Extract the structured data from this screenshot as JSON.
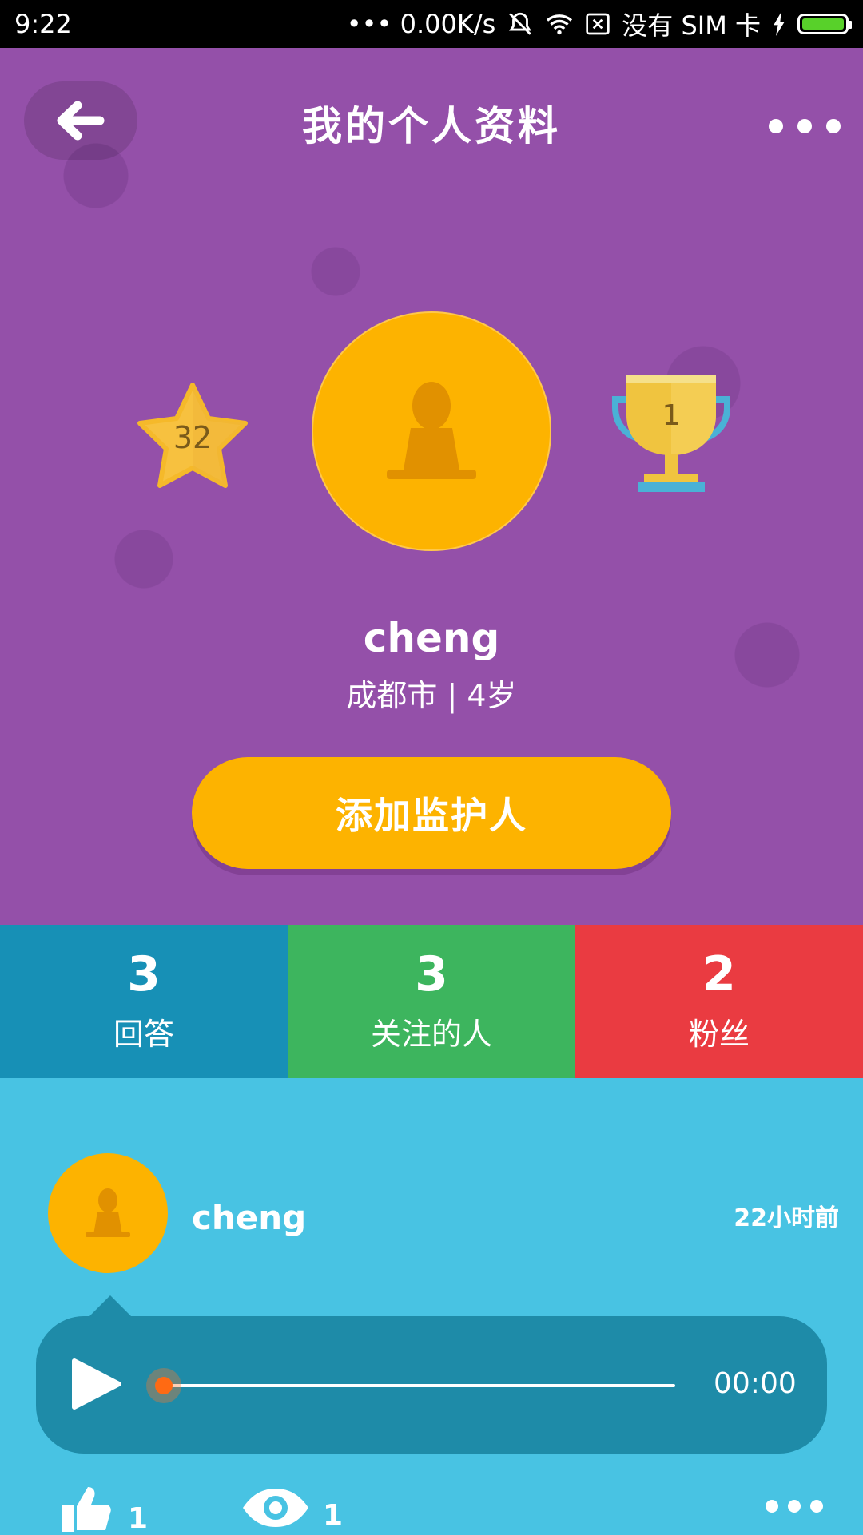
{
  "status_bar": {
    "time": "9:22",
    "net_speed": "••• 0.00K/s",
    "sim_text": "没有 SIM 卡",
    "icons": [
      "mute-icon",
      "wifi-icon",
      "no-sim-icon",
      "charging-icon",
      "battery-icon"
    ]
  },
  "header": {
    "title": "我的个人资料",
    "back_icon": "arrow-left-icon",
    "more_icon": "more-dots-icon"
  },
  "profile": {
    "star_count": "32",
    "trophy_count": "1",
    "name": "cheng",
    "location_age": "成都市 | 4岁",
    "guardian_button": "添加监护人"
  },
  "stats": [
    {
      "count": "3",
      "label": "回答",
      "color": "#1790b6"
    },
    {
      "count": "3",
      "label": "关注的人",
      "color": "#3db55e"
    },
    {
      "count": "2",
      "label": "粉丝",
      "color": "#ea3b41"
    }
  ],
  "post": {
    "author": "cheng",
    "time_ago": "22小时前",
    "audio": {
      "duration": "00:00",
      "progress": 0
    },
    "likes": "1",
    "views": "1"
  },
  "colors": {
    "hero_bg": "#9450a9",
    "accent": "#fdb300",
    "feed_bg": "#48c3e3",
    "player_bg": "#1e8ba8"
  }
}
